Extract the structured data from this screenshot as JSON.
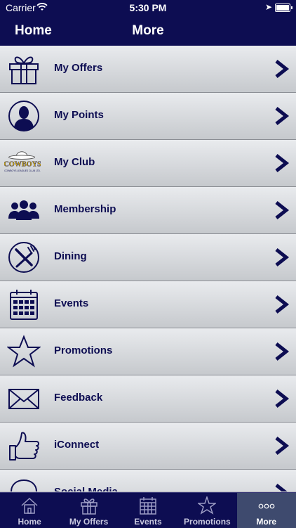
{
  "status_bar": {
    "carrier": "Carrier",
    "time": "5:30 PM"
  },
  "navbar": {
    "back_label": "Home",
    "title": "More"
  },
  "menu": [
    {
      "label": "My Offers",
      "icon": "gift-icon"
    },
    {
      "label": "My Points",
      "icon": "user-icon"
    },
    {
      "label": "My Club",
      "icon": "club-logo-icon"
    },
    {
      "label": "Membership",
      "icon": "group-icon"
    },
    {
      "label": "Dining",
      "icon": "dining-icon"
    },
    {
      "label": "Events",
      "icon": "calendar-icon"
    },
    {
      "label": "Promotions",
      "icon": "star-icon"
    },
    {
      "label": "Feedback",
      "icon": "envelope-icon"
    },
    {
      "label": "iConnect",
      "icon": "thumbs-up-icon"
    },
    {
      "label": "Social Media",
      "icon": "social-icon"
    }
  ],
  "club_logo": {
    "name": "COWBOYS",
    "sub": "COWBOYS LEAGUES CLUB LTD."
  },
  "tabs": [
    {
      "label": "Home",
      "icon": "house-icon",
      "active": false
    },
    {
      "label": "My Offers",
      "icon": "gift-icon",
      "active": false
    },
    {
      "label": "Events",
      "icon": "calendar-icon",
      "active": false
    },
    {
      "label": "Promotions",
      "icon": "star-icon",
      "active": false
    },
    {
      "label": "More",
      "icon": "more-icon",
      "active": true
    }
  ],
  "colors": {
    "navy": "#0d0d52",
    "active_tab": "#3e4a6e",
    "row_top": "#e9ebee",
    "row_bottom": "#c6c9cd"
  }
}
